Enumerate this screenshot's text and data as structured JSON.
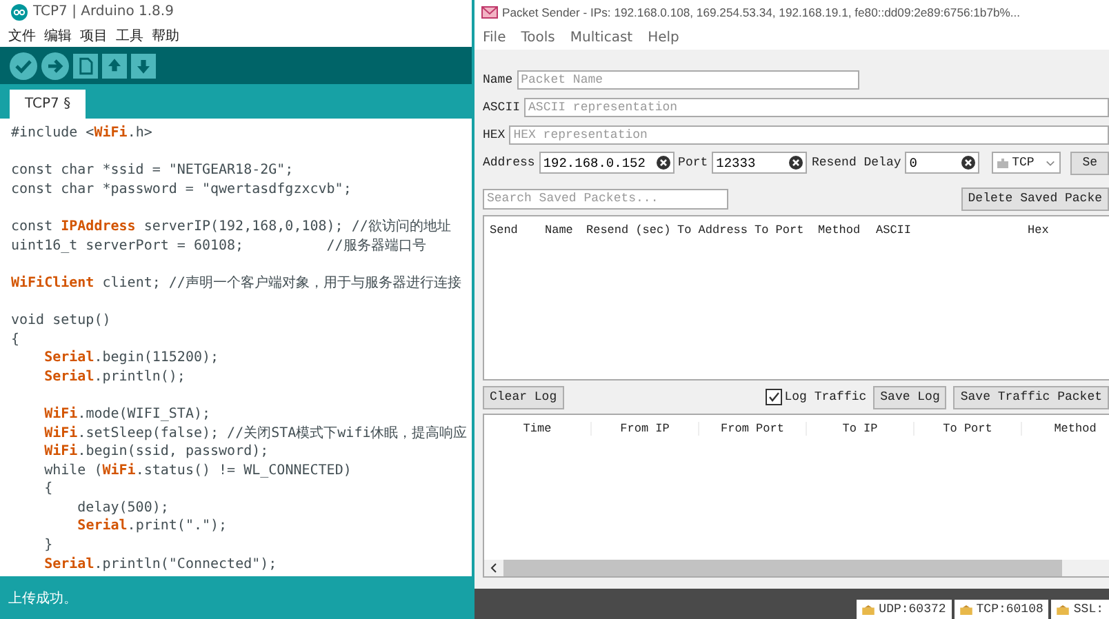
{
  "arduino": {
    "title": "TCP7 | Arduino 1.8.9",
    "menu": [
      "文件",
      "编辑",
      "项目",
      "工具",
      "帮助"
    ],
    "toolbar": [
      {
        "kind": "check"
      },
      {
        "kind": "arrow"
      },
      {
        "kind": "new"
      },
      {
        "kind": "open"
      },
      {
        "kind": "save"
      }
    ],
    "tabs": [
      {
        "label": "TCP7 §",
        "selected": true
      }
    ],
    "code": [
      {
        "kind": "code",
        "text": "#include <**WiFi**.h>"
      },
      {
        "kind": "blank"
      },
      {
        "kind": "code",
        "text": "const char *ssid = \"NETGEAR18-2G\";"
      },
      {
        "kind": "code",
        "text": "const char *password = \"qwertasdfgzxcvb\";"
      },
      {
        "kind": "blank"
      },
      {
        "kind": "code",
        "text": "const **IPAddress** serverIP(192,168,0,108); //欲访问的地址"
      },
      {
        "kind": "code",
        "text": "uint16_t serverPort = 60108;          //服务器端口号"
      },
      {
        "kind": "blank"
      },
      {
        "kind": "code",
        "text": "**WiFiClient** client; //声明一个客户端对象，用于与服务器进行连接"
      },
      {
        "kind": "blank"
      },
      {
        "kind": "code",
        "text": "void setup()"
      },
      {
        "kind": "code",
        "text": "{"
      },
      {
        "kind": "code",
        "text": "    **Serial**.begin(115200);"
      },
      {
        "kind": "code",
        "text": "    **Serial**.println();"
      },
      {
        "kind": "blank"
      },
      {
        "kind": "code",
        "text": "    **WiFi**.mode(WIFI_STA);"
      },
      {
        "kind": "code",
        "text": "    **WiFi**.setSleep(false); //关闭STA模式下wifi休眠，提高响应"
      },
      {
        "kind": "code",
        "text": "    **WiFi**.begin(ssid, password);"
      },
      {
        "kind": "code",
        "text": "    while (**WiFi**.status() != WL_CONNECTED)"
      },
      {
        "kind": "code",
        "text": "    {"
      },
      {
        "kind": "code",
        "text": "        delay(500);"
      },
      {
        "kind": "code",
        "text": "        **Serial**.print(\".\");"
      },
      {
        "kind": "code",
        "text": "    }"
      },
      {
        "kind": "code",
        "text": "    **Serial**.println(\"Connected\");"
      }
    ],
    "status": "上传成功。"
  },
  "sender": {
    "title": "Packet Sender - IPs: 192.168.0.108, 169.254.53.34, 192.168.19.1, fe80::dd09:2e89:6756:1b7b%...",
    "menu": [
      "File",
      "Tools",
      "Multicast",
      "Help"
    ],
    "name": {
      "label": "Name",
      "placeholder": "Packet Name"
    },
    "ascii": {
      "label": "ASCII",
      "placeholder": "ASCII representation"
    },
    "hex": {
      "label": "HEX",
      "placeholder": "HEX representation"
    },
    "address": {
      "label": "Address",
      "value": "192.168.0.152"
    },
    "port": {
      "label": "Port",
      "value": "12333"
    },
    "resend": {
      "label": "Resend Delay",
      "value": "0"
    },
    "protocol": "TCP",
    "send_button": "Se",
    "search": {
      "placeholder": "Search Saved Packets..."
    },
    "delete_button": "Delete Saved Packe",
    "packet_columns": [
      "Send",
      "Name",
      "Resend (sec)",
      "To Address",
      "To Port",
      "Method",
      "ASCII",
      "Hex"
    ],
    "clear_button": "Clear Log",
    "log_traffic": {
      "label": "Log Traffic",
      "checked": true
    },
    "save_log": "Save Log",
    "save_traffic": "Save Traffic Packet",
    "log_columns": [
      "Time",
      "From IP",
      "From Port",
      "To IP",
      "To Port",
      "Method"
    ],
    "ports": [
      "UDP:60372",
      "TCP:60108",
      "SSL:"
    ]
  }
}
